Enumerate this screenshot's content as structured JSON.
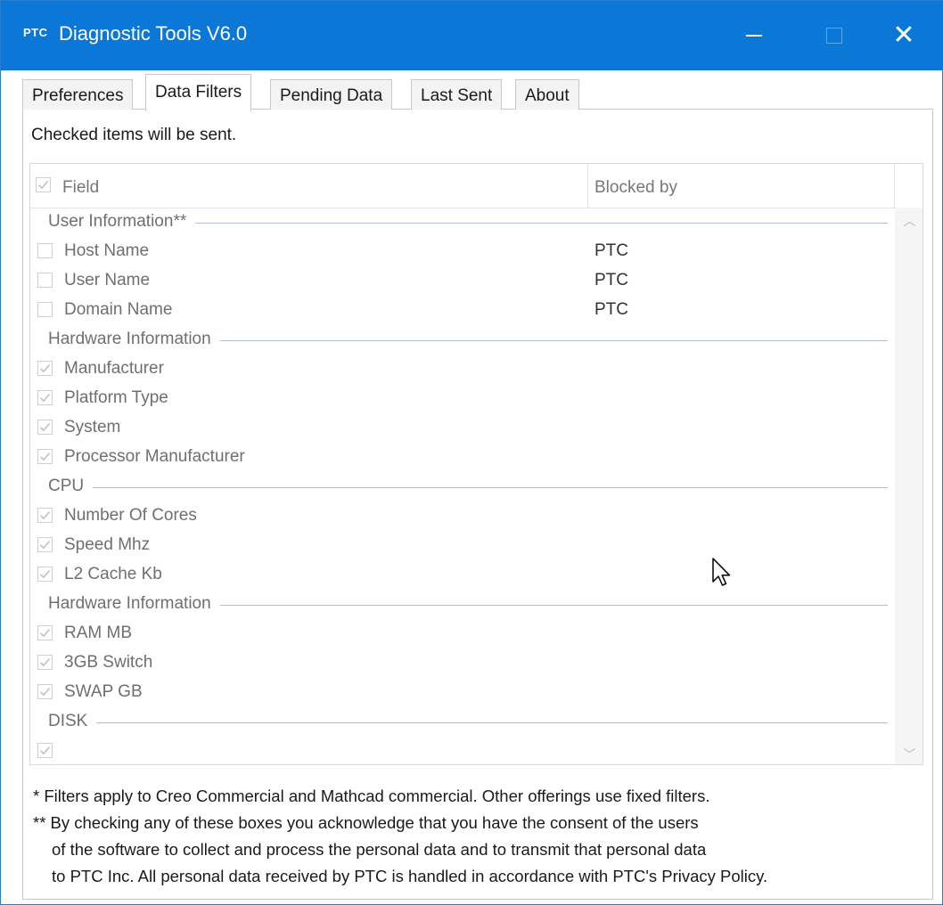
{
  "window": {
    "title": "Diagnostic Tools V6.0",
    "app_icon_text": "PTC",
    "accent": "#0b78d7"
  },
  "tabs": [
    {
      "label": "Preferences",
      "active": false
    },
    {
      "label": "Data Filters",
      "active": true
    },
    {
      "label": "Pending Data",
      "active": false
    },
    {
      "label": "Last Sent",
      "active": false
    },
    {
      "label": "About",
      "active": false
    }
  ],
  "hint": "Checked items will be sent.",
  "list": {
    "header": {
      "field": "Field",
      "blocked_by": "Blocked by",
      "all_checked": true
    },
    "groups": [
      {
        "name": "User Information**",
        "items": [
          {
            "label": "Host Name",
            "checked": false,
            "blocked_by": "PTC"
          },
          {
            "label": "User Name",
            "checked": false,
            "blocked_by": "PTC"
          },
          {
            "label": "Domain Name",
            "checked": false,
            "blocked_by": "PTC"
          }
        ]
      },
      {
        "name": "Hardware Information",
        "items": [
          {
            "label": "Manufacturer",
            "checked": true,
            "blocked_by": ""
          },
          {
            "label": "Platform Type",
            "checked": true,
            "blocked_by": ""
          },
          {
            "label": "System",
            "checked": true,
            "blocked_by": ""
          },
          {
            "label": "Processor Manufacturer",
            "checked": true,
            "blocked_by": ""
          }
        ]
      },
      {
        "name": "CPU",
        "items": [
          {
            "label": "Number Of Cores",
            "checked": true,
            "blocked_by": ""
          },
          {
            "label": "Speed Mhz",
            "checked": true,
            "blocked_by": ""
          },
          {
            "label": "L2 Cache Kb",
            "checked": true,
            "blocked_by": ""
          }
        ]
      },
      {
        "name": "Hardware Information",
        "items": [
          {
            "label": "RAM MB",
            "checked": true,
            "blocked_by": ""
          },
          {
            "label": "3GB Switch",
            "checked": true,
            "blocked_by": ""
          },
          {
            "label": "SWAP GB",
            "checked": true,
            "blocked_by": ""
          }
        ]
      },
      {
        "name": "DISK",
        "items": [
          {
            "label": "",
            "checked": true,
            "blocked_by": ""
          }
        ]
      }
    ]
  },
  "notes": {
    "line1": "* Filters apply to Creo Commercial and Mathcad commercial. Other offerings use fixed filters.",
    "line2": "** By checking any of these boxes you acknowledge that you have the consent of the users",
    "line3": "of the software to collect and process the personal data and to transmit that personal data",
    "line4": "to PTC Inc. All personal data received by PTC is handled in accordance with PTC's Privacy Policy."
  }
}
